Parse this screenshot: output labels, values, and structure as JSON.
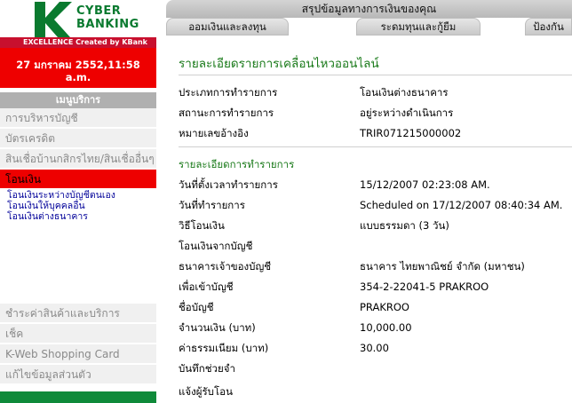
{
  "brand": {
    "logo_letter": "K",
    "line1": "CYBER",
    "line2": "BANKING",
    "tagline": "EXCELLENCE Created by KBank"
  },
  "date_display": {
    "line1": "27 มกราคม 2552,11:58",
    "line2": "a.m."
  },
  "sidebar": {
    "menu_title": "เมนูบริการ",
    "items_top": [
      {
        "label": "การบริหารบัญชี"
      },
      {
        "label": "บัตรเครดิต"
      },
      {
        "label": "สินเชื่อบ้านกสิกรไทย/สินเชื่ออื่นๆ"
      },
      {
        "label": "โอนเงิน"
      }
    ],
    "submenu": [
      {
        "label": "โอนเงินระหว่างบัญชีตนเอง"
      },
      {
        "label": "โอนเงินให้บุคคลอื่น"
      },
      {
        "label": "โอนเงินต่างธนาคาร"
      }
    ],
    "items_bottom": [
      {
        "label": "ชำระค่าสินค้าและบริการ"
      },
      {
        "label": "เช็ค"
      },
      {
        "label": "K-Web Shopping Card"
      },
      {
        "label": "แก้ไขข้อมูลส่วนตัว"
      }
    ]
  },
  "header": {
    "summary_label": "สรุปข้อมูลทางการเงินของคุณ",
    "tabs": [
      {
        "label": "ออมเงินและลงทุน"
      },
      {
        "label": "ระดมทุนและกู้ยืม"
      },
      {
        "label": "ป้องกัน"
      }
    ]
  },
  "main": {
    "title": "รายละเอียดรายการเคลื่อนไหวออนไลน์",
    "info_rows": [
      {
        "label": "ประเภทการทำรายการ",
        "value": "โอนเงินต่างธนาคาร"
      },
      {
        "label": "สถานะการทำรายการ",
        "value": "อยู่ระหว่างดำเนินการ"
      },
      {
        "label": "หมายเลขอ้างอิง",
        "value": "TRIR071215000002"
      }
    ],
    "section_title": "รายละเอียดการทำรายการ",
    "detail_rows": [
      {
        "label": "วันที่ตั้งเวลาทำรายการ",
        "value": "15/12/2007 02:23:08 AM."
      },
      {
        "label": "วันที่ทำรายการ",
        "value": "Scheduled on 17/12/2007 08:40:34 AM."
      },
      {
        "label": "วิธีโอนเงิน",
        "value": "แบบธรรมดา (3 วัน)"
      },
      {
        "label": "โอนเงินจากบัญชี",
        "value": ""
      },
      {
        "label": "ธนาคารเจ้าของบัญชี",
        "value": "ธนาคาร ไทยพาณิชย์ จำกัด (มหาชน)"
      },
      {
        "label": "เพื่อเข้าบัญชี",
        "value": "354-2-22041-5 PRAKROO"
      },
      {
        "label": "ชื่อบัญชี",
        "value": "PRAKROO"
      },
      {
        "label": "จำนวนเงิน (บาท)",
        "value": "10,000.00"
      },
      {
        "label": "ค่าธรรมเนียม (บาท)",
        "value": "30.00"
      },
      {
        "label": "บันทึกช่วยจำ",
        "value": ""
      },
      {
        "label": "แจ้งผู้รับโอน",
        "value": ""
      }
    ]
  },
  "colors": {
    "brand_green": "#0a7a2f",
    "accent_red": "#ee0000",
    "title_green": "#1a7a1a",
    "link_blue": "#000099"
  }
}
